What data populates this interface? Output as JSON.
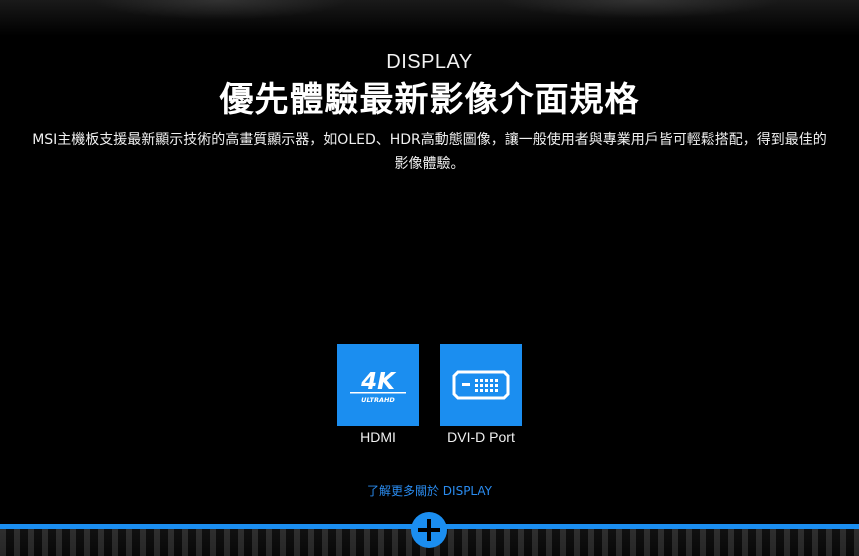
{
  "section": {
    "eyebrow": "DISPLAY",
    "title": "優先體驗最新影像介面規格",
    "description": "MSI主機板支援最新顯示技術的高畫質顯示器，如OLED、HDR高動態圖像，讓一般使用者與專業用戶皆可輕鬆搭配，得到最佳的影像體驗。"
  },
  "features": [
    {
      "label": "HDMI",
      "icon": "4k-ultra-hd-icon",
      "icon_text_main": "4K",
      "icon_text_sub": "ULTRAHD"
    },
    {
      "label": "DVI-D Port",
      "icon": "dvi-connector-icon"
    }
  ],
  "more_link": {
    "label": "了解更多關於 DISPLAY"
  },
  "colors": {
    "accent": "#1b8ef0",
    "link": "#2a8cf0",
    "background": "#000000"
  }
}
